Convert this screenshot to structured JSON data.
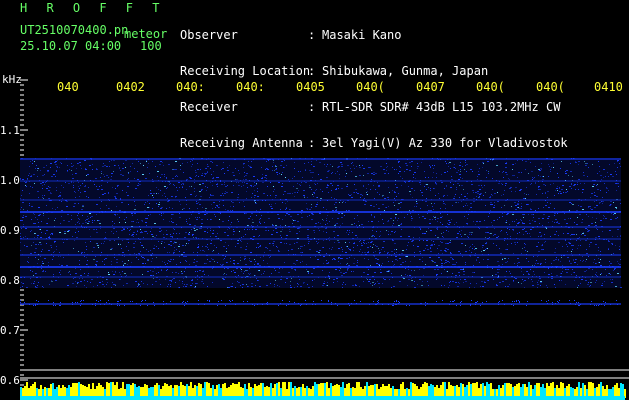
{
  "header": {
    "brand": "H R O F F T",
    "file_name": "UT2510070400.pn",
    "mode": "meteor",
    "date_time": "25.10.07 04:00",
    "count": "100"
  },
  "meta": [
    {
      "key": "Observer",
      "value": "Masaki Kano"
    },
    {
      "key": "Receiving Location",
      "value": "Shibukawa, Gunma, Japan"
    },
    {
      "key": "Receiver",
      "value": "RTL-SDR SDR# 43dB L15 103.2MHz CW"
    },
    {
      "key": "Receiving Antenna",
      "value": "3el Yagi(V) Az 330 for Vladivostok"
    }
  ],
  "axis": {
    "unit": "kHz",
    "y_ticks": [
      "1.1",
      "1.0",
      "0.9",
      "0.8",
      "0.7",
      "0.6"
    ],
    "time_ticks": [
      "040",
      "0402",
      "040:",
      "040:",
      "0405",
      "040(",
      "0407",
      "040(",
      "040(",
      "0410"
    ]
  },
  "colors": {
    "background": "#000000",
    "text_white": "#ffffff",
    "text_green": "#66ff66",
    "text_yellow": "#ffff33",
    "noise": "#1a3cff",
    "strong": "#5fd8ff",
    "meter_yellow": "#ffff00",
    "meter_cyan": "#00e5ff"
  }
}
